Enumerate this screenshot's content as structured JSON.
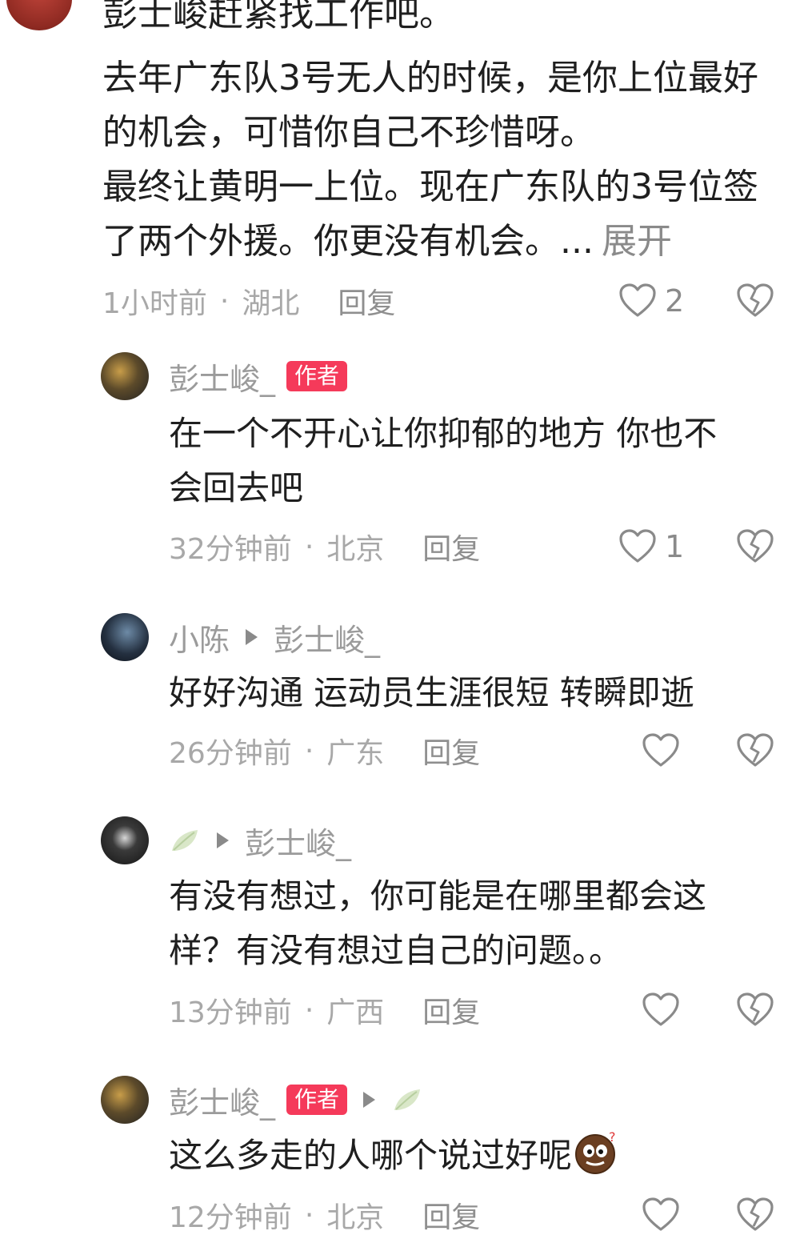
{
  "main_comment": {
    "cut_line": "彭士峻赶紧找工作吧。",
    "lines": [
      "去年广东队3号无人的时候，是你上位最好",
      "的机会，可惜你自己不珍惜呀。",
      "最终让黄明一上位。现在广东队的3号位签",
      "了两个外援。你更没有机会。..."
    ],
    "expand_label": "展开",
    "time": "1小时前",
    "separator": "·",
    "location": "湖北",
    "reply_label": "回复",
    "like_count": "2"
  },
  "replies": [
    {
      "username": "彭士峻_",
      "badge": "作者",
      "lines": [
        "在一个不开心让你抑郁的地方 你也不",
        "会回去吧"
      ],
      "time": "32分钟前",
      "separator": "·",
      "location": "北京",
      "reply_label": "回复",
      "like_count": "1"
    },
    {
      "username": "小陈",
      "reply_to": "彭士峻_",
      "lines": [
        "好好沟通 运动员生涯很短 转瞬即逝"
      ],
      "time": "26分钟前",
      "separator": "·",
      "location": "广东",
      "reply_label": "回复"
    },
    {
      "username_icon": "leaf-icon",
      "reply_to": "彭士峻_",
      "lines": [
        "有没有想过，你可能是在哪里都会这",
        "样？有没有想过自己的问题。。"
      ],
      "time": "13分钟前",
      "separator": "·",
      "location": "广西",
      "reply_label": "回复"
    },
    {
      "username": "彭士峻_",
      "badge": "作者",
      "reply_to_icon": "leaf-icon",
      "lines": [
        "这么多走的人哪个说过好呢"
      ],
      "emoji": "thinking-face-emoji",
      "time": "12分钟前",
      "separator": "·",
      "location": "北京",
      "reply_label": "回复"
    }
  ],
  "icons": {
    "like": "heart-icon",
    "dislike": "broken-heart-icon"
  },
  "colors": {
    "badge": "#f53a5a",
    "meta_text": "#a8a8a8",
    "body_text": "#1f1f1f"
  }
}
